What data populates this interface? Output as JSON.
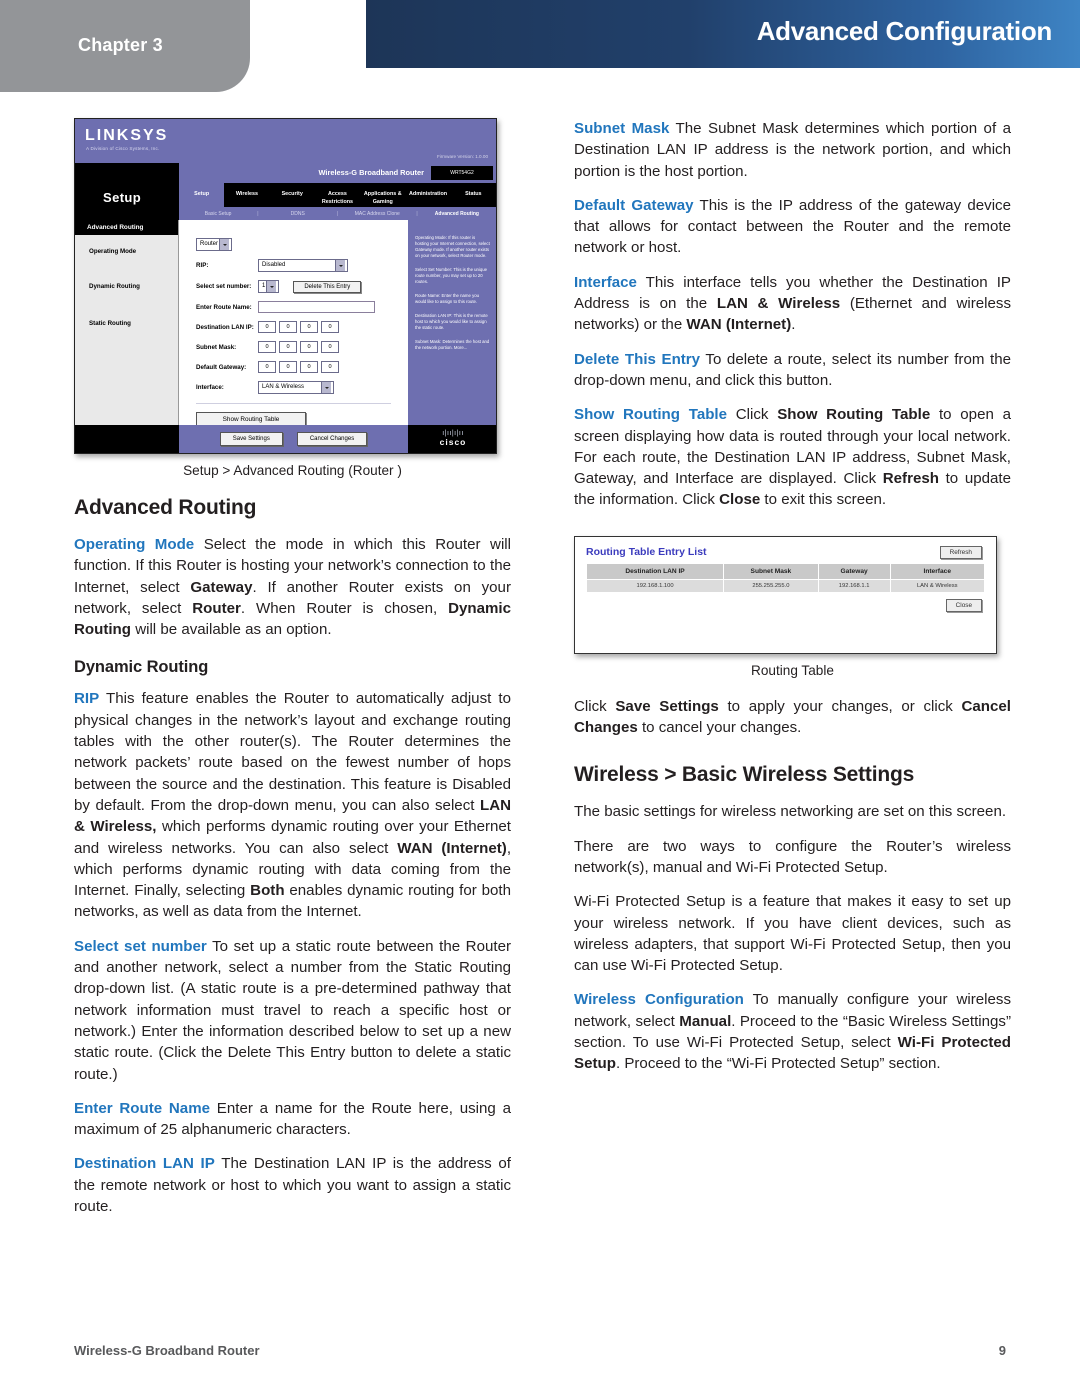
{
  "header": {
    "chapter_label": "Chapter 3",
    "title": "Advanced Configuration",
    "gradient_from": "#1d3557",
    "gradient_to": "#3e84c4",
    "chapter_tab_color": "#939598"
  },
  "accent_color": "#2176bd",
  "left_column": {
    "figure": {
      "caption": "Setup > Advanced Routing (Router )",
      "screenshot": {
        "brand": "LINKSYS",
        "brand_sub": "A Division of Cisco Systems, Inc.",
        "firmware": "Firmware Version: 1.0.00",
        "model_name": "Wireless-G Broadband Router",
        "model_code": "WRT54G2",
        "side_title": "Setup",
        "nav_tabs": [
          "Setup",
          "Wireless",
          "Security",
          "Access Restrictions",
          "Applications & Gaming",
          "Administration",
          "Status"
        ],
        "sub_nav": [
          "Basic Setup",
          "DDNS",
          "MAC Address Clone",
          "Advanced Routing"
        ],
        "panel_title": "Advanced Routing",
        "side_labels": [
          "Operating Mode",
          "Dynamic Routing",
          "Static Routing"
        ],
        "fields": {
          "operating_mode_label": "Operating Mode:",
          "operating_mode_value": "Router",
          "rip_label": "RIP:",
          "rip_value": "Disabled",
          "select_set_number_label": "Select set number:",
          "select_set_number_value": "1",
          "delete_entry_button": "Delete This Entry",
          "route_name_label": "Enter Route Name:",
          "route_name_value": "",
          "destination_lan_ip_label": "Destination LAN IP:",
          "destination_lan_ip_octets": [
            "0",
            "0",
            "0",
            "0"
          ],
          "subnet_mask_label": "Subnet Mask:",
          "subnet_mask_octets": [
            "0",
            "0",
            "0",
            "0"
          ],
          "default_gateway_label": "Default Gateway:",
          "default_gateway_octets": [
            "0",
            "0",
            "0",
            "0"
          ],
          "interface_label": "Interface:",
          "interface_value": "LAN & Wireless",
          "show_routing_table_button": "Show Routing Table"
        },
        "help_panel": [
          "Operating Mode: If this router is hosting your Internet connection, select Gateway mode. If another router exists on your network, select Router mode.",
          "Select Set Number: This is the unique route number, you may set up to 20 routes.",
          "Route Name: Enter the name you would like to assign to this route.",
          "Destination LAN IP: This is the remote host to which you would like to assign the static route.",
          "Subnet Mask: Determines the host and the network portion. More..."
        ],
        "footer_buttons": [
          "Save Settings",
          "Cancel Changes"
        ],
        "cisco_logo_word": "cisco"
      }
    },
    "section_title": "Advanced Routing",
    "paragraphs": [
      {
        "term": "Operating Mode",
        "html": " Select the mode in which this Router will function. If this Router is hosting your network’s connection to the Internet, select <b>Gateway</b>. If another Router exists on your network, select <b>Router</b>. When Router is chosen, <b>Dynamic Routing</b> will be available as an option."
      }
    ],
    "subsection_title": "Dynamic Routing",
    "dynamic_paragraphs": [
      {
        "term": "RIP",
        "html": " This feature enables the Router to automatically adjust to physical changes in the network’s layout and exchange routing tables with the other router(s). The Router determines the network packets’ route based on the fewest number of hops between the source and the destination. This feature is Disabled by default. From the drop-down menu, you can also select <b>LAN &amp; Wireless,</b> which performs dynamic routing over your Ethernet and wireless networks. You can also select <b>WAN (Internet)</b>, which performs dynamic routing with data coming from the Internet. Finally, selecting <b>Both</b> enables dynamic routing for both networks, as well as data from the Internet."
      },
      {
        "term": "Select set number",
        "html": " To set up a static route between the Router and another network, select a number from the Static Routing drop-down list. (A static route is a pre-determined pathway that network information must travel to reach a specific host or network.) Enter the information described below to set up a new static route. (Click the Delete This Entry button to delete a static route.)"
      },
      {
        "term": "Enter Route Name",
        "html": " Enter a name for the Route here, using a maximum of 25 alphanumeric characters."
      },
      {
        "term": "Destination LAN IP",
        "html": " The Destination LAN IP is the address of the remote network or host to which you want to assign a static route."
      }
    ]
  },
  "right_column": {
    "paragraphs": [
      {
        "term": "Subnet Mask",
        "html": " The Subnet Mask determines which portion of a Destination LAN IP address is the network portion, and which portion is the host portion."
      },
      {
        "term": "Default Gateway",
        "html": " This is the IP address of the gateway device that allows for contact between the Router and the remote network or host."
      },
      {
        "term": "Interface",
        "html": " This interface tells you whether the Destination IP Address is on the <b>LAN &amp; Wireless</b> (Ethernet and wireless networks) or the <b>WAN (Internet)</b>."
      },
      {
        "term": "Delete This Entry",
        "html": " To delete a route, select its number from the drop-down menu, and click this button."
      },
      {
        "term": "Show Routing Table",
        "html": " Click <b>Show Routing Table</b> to open a screen displaying how data is routed through your local network. For each route, the Destination LAN IP address, Subnet Mask, Gateway, and Interface are displayed. Click <b>Refresh</b> to update the information. Click <b>Close</b> to exit this screen."
      }
    ],
    "routing_figure": {
      "caption": "Routing Table",
      "title": "Routing Table Entry List",
      "refresh_button": "Refresh",
      "close_button": "Close",
      "columns": [
        "Destination LAN IP",
        "Subnet Mask",
        "Gateway",
        "Interface"
      ],
      "rows": [
        [
          "192.168.1.100",
          "255.255.255.0",
          "192.168.1.1",
          "LAN & Wireless"
        ]
      ]
    },
    "save_paragraph_html": "Click <b>Save Settings</b> to apply your changes, or click <b>Cancel Changes</b> to cancel your changes.",
    "section_title": "Wireless > Basic Wireless Settings",
    "after_section_paragraphs": [
      {
        "term": "",
        "html": "The basic settings for wireless networking are set on this screen."
      },
      {
        "term": "",
        "html": "There are two ways to configure the Router’s wireless network(s), manual and Wi-Fi Protected Setup."
      },
      {
        "term": "",
        "html": "Wi-Fi Protected Setup is a feature that makes it easy to set up your wireless network. If you have client devices, such as wireless adapters, that support Wi-Fi Protected Setup, then you can use Wi-Fi Protected Setup."
      },
      {
        "term": "Wireless Configuration",
        "html": " To manually configure your wireless network, select <b>Manual</b>. Proceed to the “Basic Wireless Settings” section. To use Wi-Fi Protected Setup, select <b>Wi-Fi Protected Setup</b>. Proceed to the “Wi-Fi Protected Setup” section."
      }
    ]
  },
  "footer": {
    "left": "Wireless-G Broadband Router",
    "page_number": "9"
  }
}
